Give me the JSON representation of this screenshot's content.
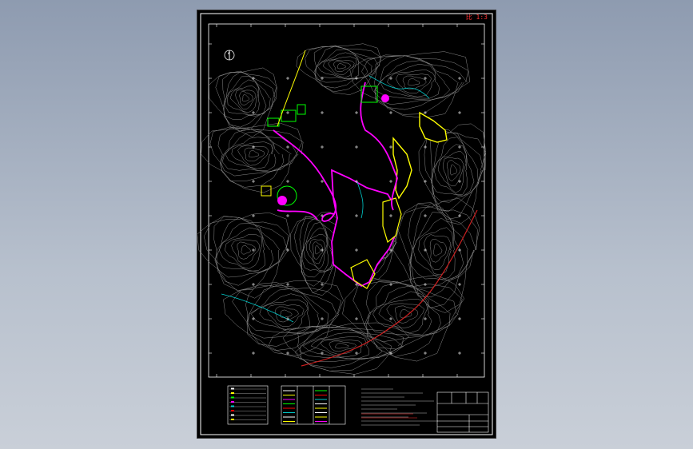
{
  "drawing": {
    "scale_label": "比 1:3"
  },
  "colors": {
    "background": "#000000",
    "frame": "#ffffff",
    "contour": "#8a8a8a",
    "road_magenta": "#ff00ff",
    "boundary_yellow": "#ffff00",
    "stream_cyan": "#00cccc",
    "facility_green": "#00ff00",
    "river_red": "#cc2020"
  },
  "icons": [
    "north-arrow-icon"
  ]
}
